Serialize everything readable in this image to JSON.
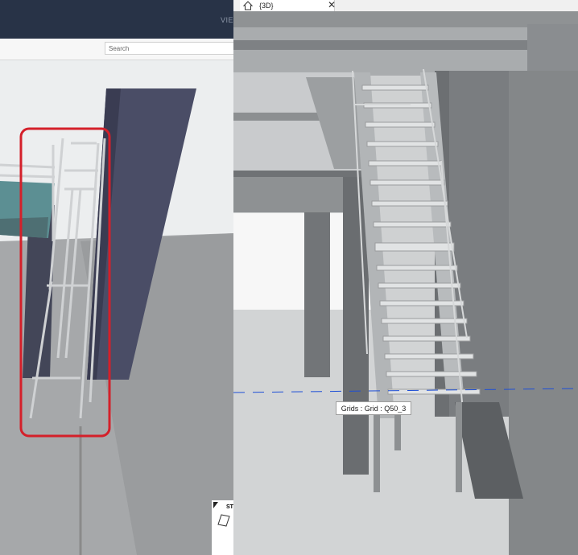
{
  "left_viewer": {
    "header_label": "VIE",
    "search": {
      "placeholder": "Search",
      "value": ""
    }
  },
  "revit_view": {
    "tab_title": "{3D}",
    "tab_close_glyph": "✕",
    "tooltip": "Grids : Grid : Q50_3"
  },
  "viewcube_label": "ST",
  "colors": {
    "viewer_header": "#283347",
    "highlight_box": "#d4202a",
    "grid_line": "#1e4fd6",
    "wall_dark": "#4a4d66"
  },
  "icons": [
    "home-icon",
    "close-icon",
    "viewcube-icon"
  ]
}
